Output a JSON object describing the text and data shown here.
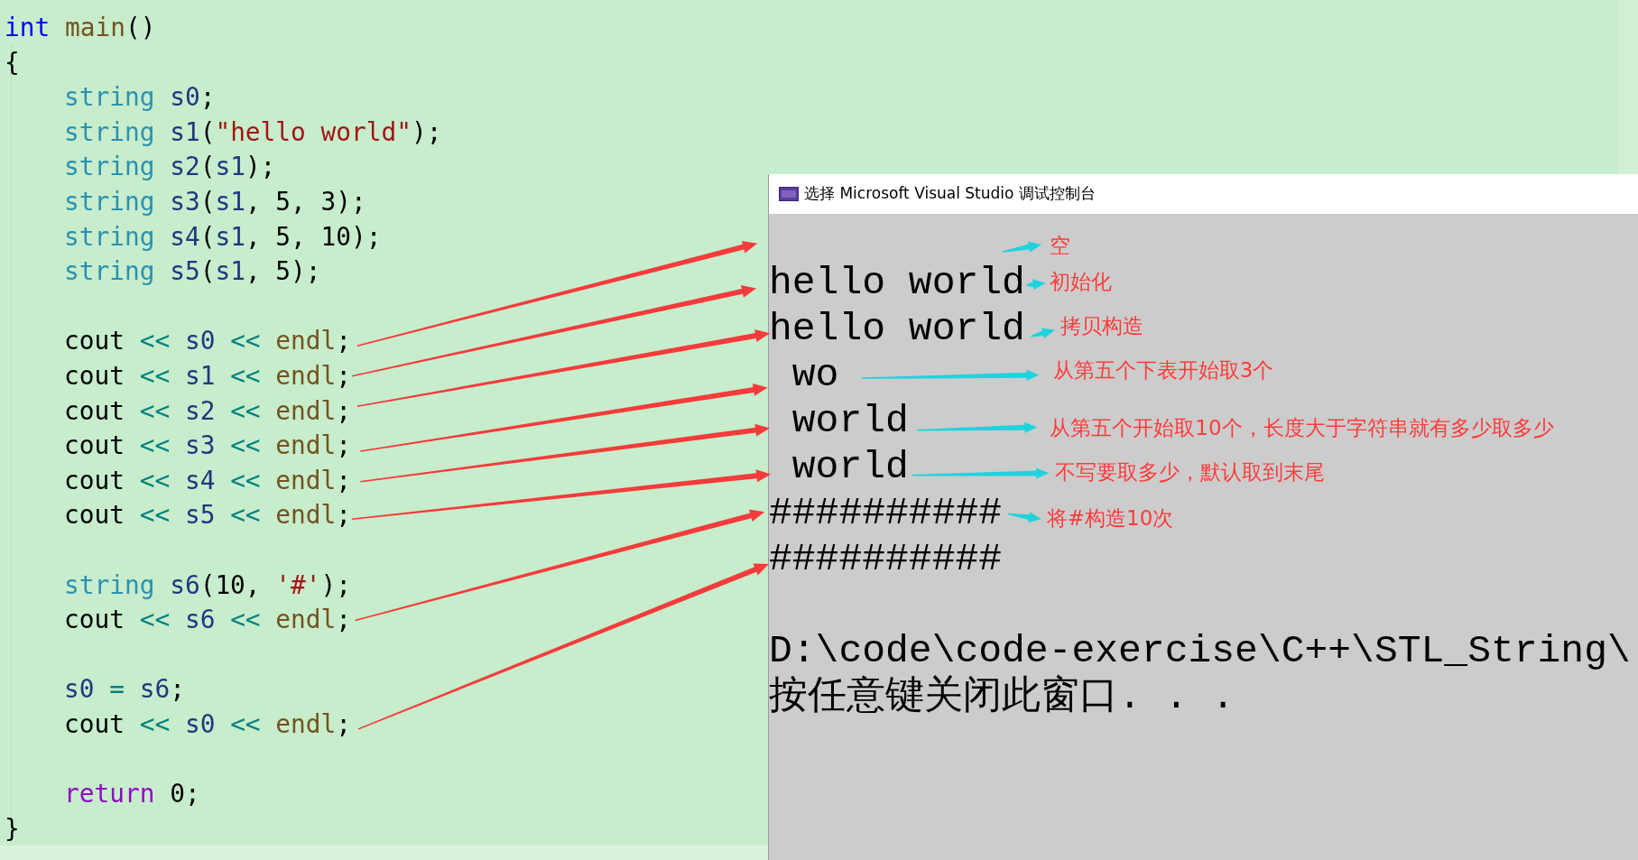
{
  "editor": {
    "lines": [
      {
        "kind": "code",
        "tokens": [
          {
            "text": "int ",
            "kind": "keyword"
          },
          {
            "text": "main",
            "kind": "func"
          },
          {
            "text": "()"
          }
        ]
      },
      {
        "kind": "code",
        "tokens": [
          {
            "text": "{"
          }
        ],
        "children": [
          {
            "kind": "code",
            "tokens": [
              {
                "text": "string ",
                "kind": "type"
              },
              {
                "text": "s0",
                "kind": "var"
              },
              {
                "text": ";"
              }
            ]
          },
          {
            "kind": "code",
            "tokens": [
              {
                "text": "string ",
                "kind": "type"
              },
              {
                "text": "s1",
                "kind": "var"
              },
              {
                "text": "("
              },
              {
                "text": "\"hello world\"",
                "kind": "str"
              },
              {
                "text": ");"
              }
            ]
          },
          {
            "kind": "code",
            "tokens": [
              {
                "text": "string ",
                "kind": "type"
              },
              {
                "text": "s2",
                "kind": "var"
              },
              {
                "text": "("
              },
              {
                "text": "s1",
                "kind": "var"
              },
              {
                "text": ");"
              }
            ]
          },
          {
            "kind": "code",
            "tokens": [
              {
                "text": "string ",
                "kind": "type"
              },
              {
                "text": "s3",
                "kind": "var"
              },
              {
                "text": "("
              },
              {
                "text": "s1",
                "kind": "var"
              },
              {
                "text": ", 5, 3);"
              }
            ]
          },
          {
            "kind": "code",
            "tokens": [
              {
                "text": "string ",
                "kind": "type"
              },
              {
                "text": "s4",
                "kind": "var"
              },
              {
                "text": "("
              },
              {
                "text": "s1",
                "kind": "var"
              },
              {
                "text": ", 5, 10);"
              }
            ]
          },
          {
            "kind": "code",
            "tokens": [
              {
                "text": "string ",
                "kind": "type"
              },
              {
                "text": "s5",
                "kind": "var"
              },
              {
                "text": "("
              },
              {
                "text": "s1",
                "kind": "var"
              },
              {
                "text": ", 5);"
              }
            ]
          },
          {
            "kind": "blank"
          },
          {
            "kind": "code",
            "tokens": [
              {
                "text": "cout "
              },
              {
                "text": "<< ",
                "kind": "op"
              },
              {
                "text": "s0 ",
                "kind": "var"
              },
              {
                "text": "<< ",
                "kind": "op"
              },
              {
                "text": "endl",
                "kind": "func"
              },
              {
                "text": ";"
              }
            ]
          },
          {
            "kind": "code",
            "tokens": [
              {
                "text": "cout "
              },
              {
                "text": "<< ",
                "kind": "op"
              },
              {
                "text": "s1 ",
                "kind": "var"
              },
              {
                "text": "<< ",
                "kind": "op"
              },
              {
                "text": "endl",
                "kind": "func"
              },
              {
                "text": ";"
              }
            ]
          },
          {
            "kind": "code",
            "tokens": [
              {
                "text": "cout "
              },
              {
                "text": "<< ",
                "kind": "op"
              },
              {
                "text": "s2 ",
                "kind": "var"
              },
              {
                "text": "<< ",
                "kind": "op"
              },
              {
                "text": "endl",
                "kind": "func"
              },
              {
                "text": ";"
              }
            ]
          },
          {
            "kind": "code",
            "tokens": [
              {
                "text": "cout "
              },
              {
                "text": "<< ",
                "kind": "op"
              },
              {
                "text": "s3 ",
                "kind": "var"
              },
              {
                "text": "<< ",
                "kind": "op"
              },
              {
                "text": "endl",
                "kind": "func"
              },
              {
                "text": ";"
              }
            ]
          },
          {
            "kind": "code",
            "tokens": [
              {
                "text": "cout "
              },
              {
                "text": "<< ",
                "kind": "op"
              },
              {
                "text": "s4 ",
                "kind": "var"
              },
              {
                "text": "<< ",
                "kind": "op"
              },
              {
                "text": "endl",
                "kind": "func"
              },
              {
                "text": ";"
              }
            ]
          },
          {
            "kind": "code",
            "tokens": [
              {
                "text": "cout "
              },
              {
                "text": "<< ",
                "kind": "op"
              },
              {
                "text": "s5 ",
                "kind": "var"
              },
              {
                "text": "<< ",
                "kind": "op"
              },
              {
                "text": "endl",
                "kind": "func"
              },
              {
                "text": ";"
              }
            ]
          },
          {
            "kind": "blank"
          },
          {
            "kind": "code",
            "tokens": [
              {
                "text": "string ",
                "kind": "type"
              },
              {
                "text": "s6",
                "kind": "var"
              },
              {
                "text": "(10, "
              },
              {
                "text": "'#'",
                "kind": "str"
              },
              {
                "text": ");"
              }
            ]
          },
          {
            "kind": "code",
            "tokens": [
              {
                "text": "cout "
              },
              {
                "text": "<< ",
                "kind": "op"
              },
              {
                "text": "s6 ",
                "kind": "var"
              },
              {
                "text": "<< ",
                "kind": "op"
              },
              {
                "text": "endl",
                "kind": "func"
              },
              {
                "text": ";"
              }
            ]
          },
          {
            "kind": "blank"
          },
          {
            "kind": "code",
            "tokens": [
              {
                "text": "s0 ",
                "kind": "var"
              },
              {
                "text": "= ",
                "kind": "op"
              },
              {
                "text": "s6",
                "kind": "var"
              },
              {
                "text": ";"
              }
            ]
          },
          {
            "kind": "code",
            "tokens": [
              {
                "text": "cout "
              },
              {
                "text": "<< ",
                "kind": "op"
              },
              {
                "text": "s0 ",
                "kind": "var"
              },
              {
                "text": "<< ",
                "kind": "op"
              },
              {
                "text": "endl",
                "kind": "func"
              },
              {
                "text": ";"
              }
            ]
          },
          {
            "kind": "blank"
          },
          {
            "kind": "code",
            "tokens": [
              {
                "text": "return ",
                "kind": "control"
              },
              {
                "text": "0;"
              }
            ]
          }
        ]
      },
      {
        "kind": "code",
        "tokens": [
          {
            "text": "}"
          }
        ]
      }
    ]
  },
  "console": {
    "title": "选择 Microsoft Visual Studio 调试控制台",
    "lines": [
      {
        "kind": "blank"
      },
      {
        "kind": "text",
        "text": "hello world"
      },
      {
        "kind": "text",
        "text": "hello world"
      },
      {
        "kind": "text",
        "text": " wo"
      },
      {
        "kind": "text",
        "text": " world"
      },
      {
        "kind": "text",
        "text": " world"
      },
      {
        "kind": "text",
        "text": "##########"
      },
      {
        "kind": "text",
        "text": "##########"
      },
      {
        "kind": "blank"
      },
      {
        "kind": "text",
        "text": "D:\\code\\code-exercise\\C++\\STL_String\\"
      },
      {
        "kind": "text",
        "text": "按任意键关闭此窗口. . ."
      }
    ]
  },
  "annotations": [
    {
      "text": "空"
    },
    {
      "text": "初始化"
    },
    {
      "text": "拷贝构造"
    },
    {
      "text": "从第五个下表开始取3个"
    },
    {
      "text": "从第五个开始取10个，长度大于字符串就有多少取多少"
    },
    {
      "text": "不写要取多少，默认取到末尾"
    },
    {
      "text": "将#构造10次"
    }
  ]
}
